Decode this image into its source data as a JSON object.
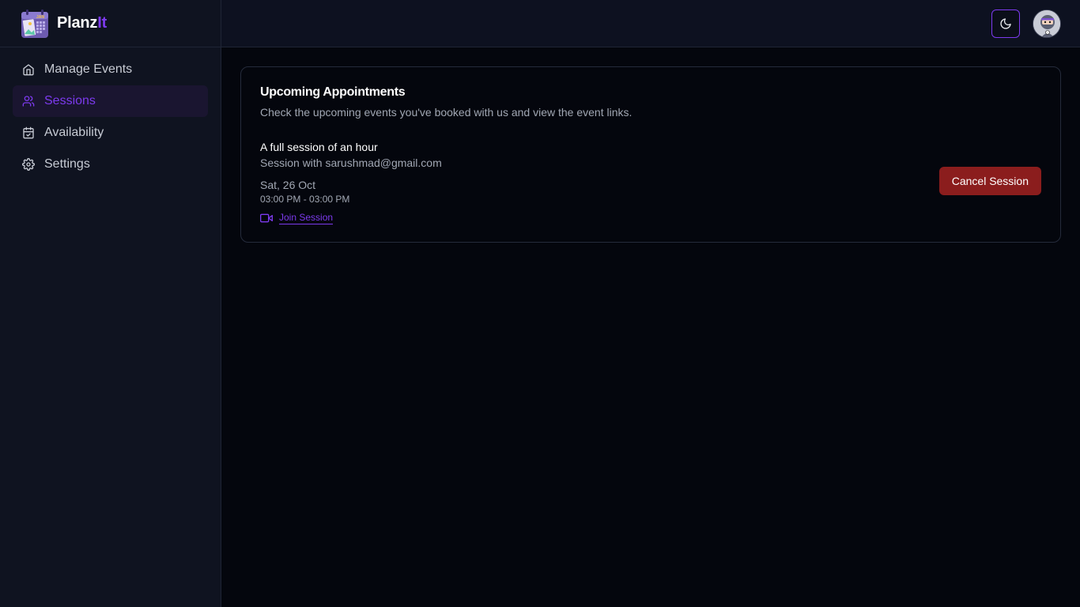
{
  "brand": {
    "name_main": "Planz",
    "name_accent": "It",
    "logo_icon": "calendar-logo-icon",
    "logo_text": "JAN"
  },
  "sidebar": {
    "items": [
      {
        "label": "Manage Events",
        "icon": "home-icon",
        "active": false
      },
      {
        "label": "Sessions",
        "icon": "users-icon",
        "active": true
      },
      {
        "label": "Availability",
        "icon": "calendar-check-icon",
        "active": false
      },
      {
        "label": "Settings",
        "icon": "gear-icon",
        "active": false
      }
    ]
  },
  "header": {
    "theme_toggle_icon": "moon-icon",
    "avatar_icon": "user-avatar"
  },
  "appointments": {
    "title": "Upcoming Appointments",
    "description": "Check the upcoming events you've booked with us and view the event links.",
    "sessions": [
      {
        "title": "A full session of an hour",
        "with": "Session with sarushmad@gmail.com",
        "date": "Sat, 26 Oct",
        "time": "03:00 PM - 03:00 PM",
        "join_label": "Join Session",
        "cancel_label": "Cancel Session"
      }
    ]
  },
  "colors": {
    "accent": "#7c3aed",
    "danger": "#8b1d1d",
    "background": "#04060d",
    "sidebar": "#0f1320"
  }
}
